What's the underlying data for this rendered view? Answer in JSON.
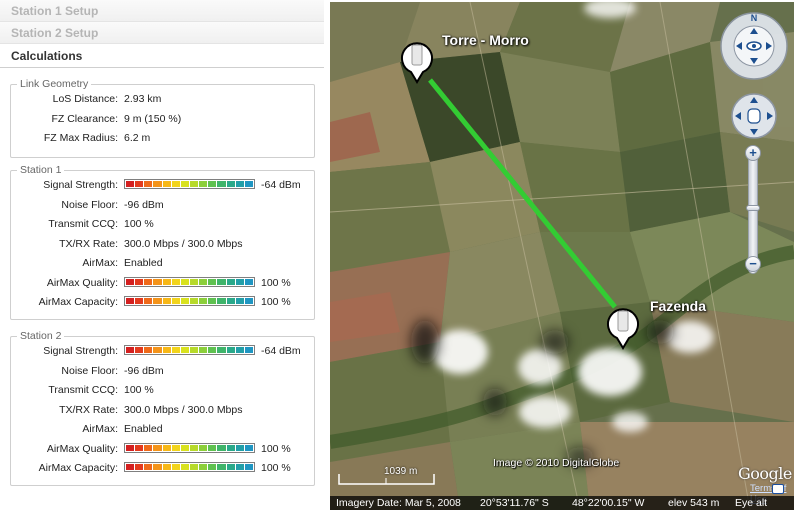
{
  "sections": {
    "station1_setup": "Station 1 Setup",
    "station2_setup": "Station 2 Setup",
    "calculations": "Calculations"
  },
  "link_geometry": {
    "legend": "Link Geometry",
    "rows": [
      {
        "label": "LoS Distance:",
        "value": "2.93 km"
      },
      {
        "label": "FZ Clearance:",
        "value": "9 m  (150 %)"
      },
      {
        "label": "FZ Max Radius:",
        "value": "6.2 m"
      }
    ]
  },
  "station1": {
    "legend": "Station 1",
    "signal_label": "Signal Strength:",
    "signal_value": "-64 dBm",
    "signal_level": 1.0,
    "noise_label": "Noise Floor:",
    "noise_value": "-96 dBm",
    "ccq_label": "Transmit CCQ:",
    "ccq_value": "100 %",
    "rate_label": "TX/RX Rate:",
    "rate_value": "300.0 Mbps / 300.0 Mbps",
    "airmax_label": "AirMax:",
    "airmax_value": "Enabled",
    "quality_label": "AirMax Quality:",
    "quality_value": "100 %",
    "quality_level": 1.0,
    "capacity_label": "AirMax Capacity:",
    "capacity_value": "100 %",
    "capacity_level": 1.0
  },
  "station2": {
    "legend": "Station 2",
    "signal_label": "Signal Strength:",
    "signal_value": "-64 dBm",
    "signal_level": 1.0,
    "noise_label": "Noise Floor:",
    "noise_value": "-96 dBm",
    "ccq_label": "Transmit CCQ:",
    "ccq_value": "100 %",
    "rate_label": "TX/RX Rate:",
    "rate_value": "300.0 Mbps / 300.0 Mbps",
    "airmax_label": "AirMax:",
    "airmax_value": "Enabled",
    "quality_label": "AirMax Quality:",
    "quality_value": "100 %",
    "quality_level": 1.0,
    "capacity_label": "AirMax Capacity:",
    "capacity_value": "100 %",
    "capacity_level": 1.0
  },
  "bar_colors": [
    "#d42020",
    "#e33a1e",
    "#ef6a1a",
    "#f4941a",
    "#f7b817",
    "#f2d41c",
    "#d9e21f",
    "#b7da2a",
    "#8ccf3a",
    "#5fc150",
    "#3fb46a",
    "#2aa98a",
    "#229fa8",
    "#1f96c2"
  ],
  "map": {
    "pin1_name": "Torre - Morro",
    "pin2_name": "Fazenda",
    "link_color": "#33cc33",
    "scale_label": "1039 m",
    "credit": "Image © 2010 DigitalGlobe",
    "google": "Google",
    "terms": "Terms of Use",
    "status": {
      "date": "Imagery Date: Mar 5, 2008",
      "lat": "20°53'11.76\" S",
      "lon": "48°22'00.15\" W",
      "elev": "elev  543 m",
      "eye": "Eye alt"
    }
  }
}
